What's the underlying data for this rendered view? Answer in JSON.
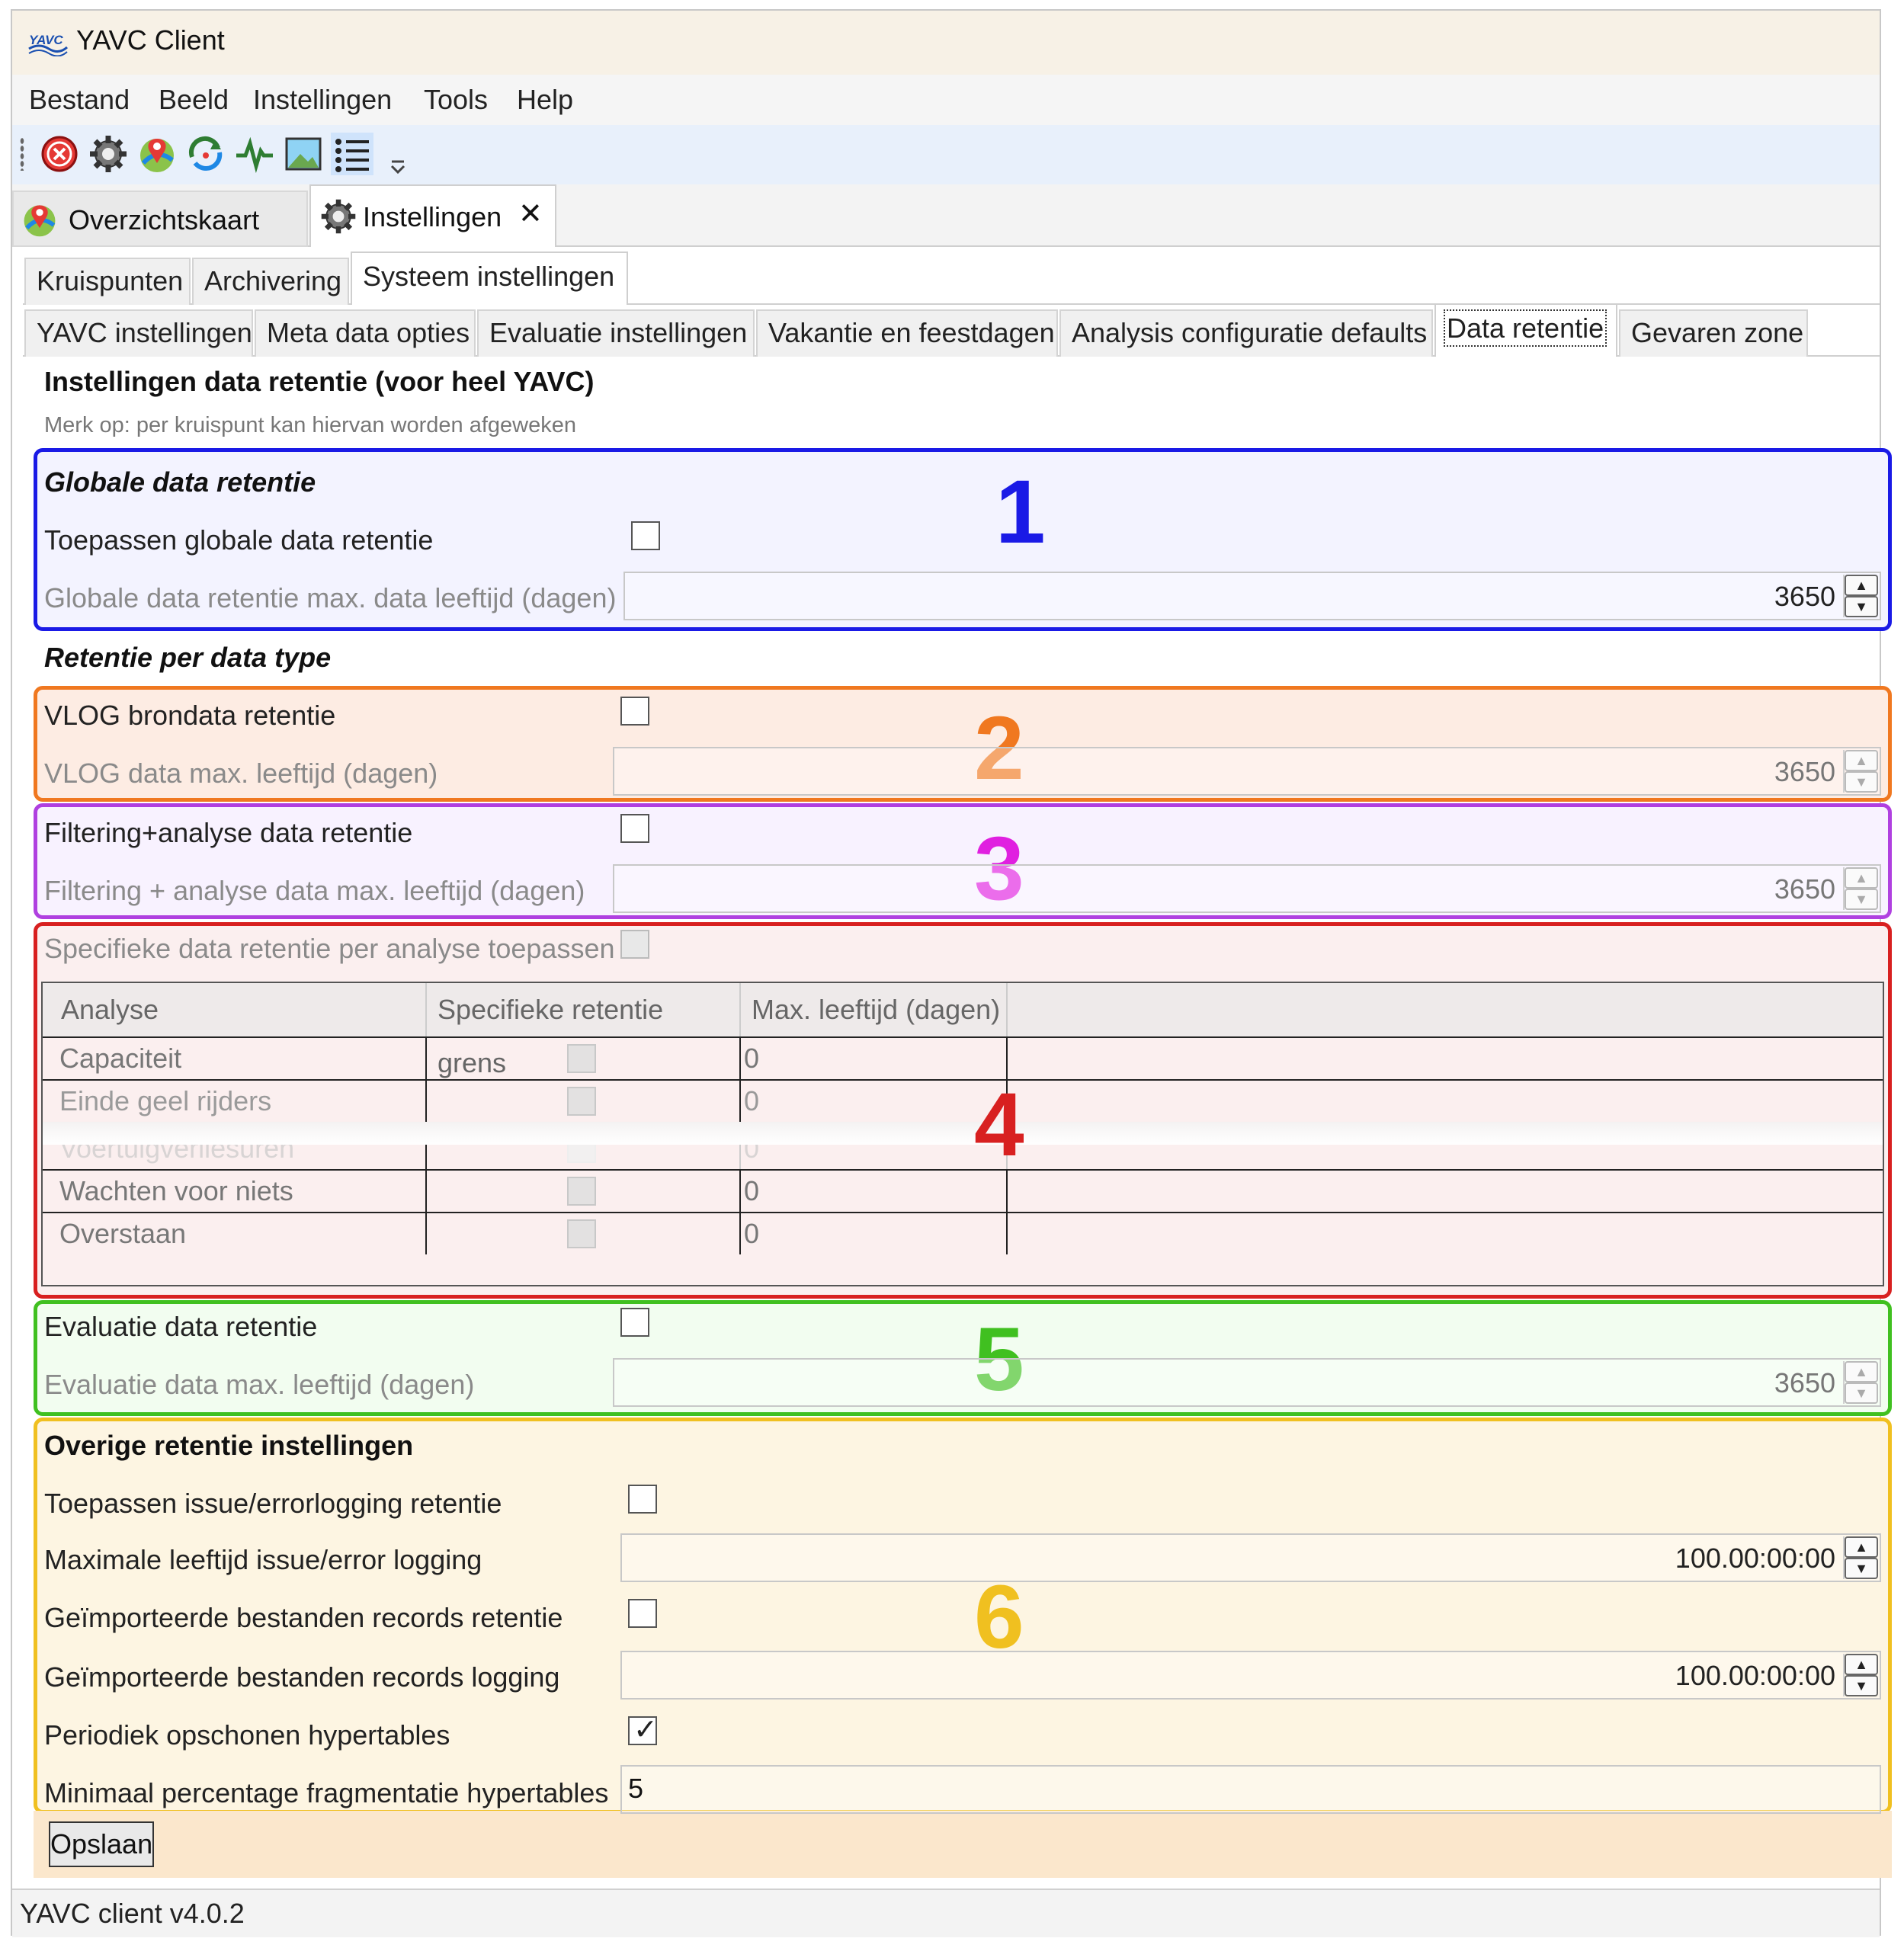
{
  "window": {
    "title": "YAVC Client",
    "logo_text": "YAVC"
  },
  "menu": [
    "Bestand",
    "Beeld",
    "Instellingen",
    "Tools",
    "Help"
  ],
  "toolbar": {
    "icons": [
      "close-red-icon",
      "gear-icon",
      "map-pin-icon",
      "refresh-icon",
      "pulse-icon",
      "image-icon",
      "list-icon",
      "overflow-chevron-icon"
    ]
  },
  "doc_tabs": [
    {
      "label": "Overzichtskaart",
      "icon": "map-pin-icon"
    },
    {
      "label": "Instellingen",
      "icon": "gear-icon",
      "close": "✕"
    }
  ],
  "settings_tabs": [
    "Kruispunten",
    "Archivering",
    "Systeem instellingen"
  ],
  "system_tabs": [
    "YAVC instellingen",
    "Meta data opties",
    "Evaluatie instellingen",
    "Vakantie en feestdagen",
    "Analysis configuratie defaults",
    "Data retentie",
    "Gevaren zone"
  ],
  "content": {
    "title": "Instellingen data retentie (voor heel YAVC)",
    "note": "Merk op: per kruispunt kan hiervan worden afgeweken"
  },
  "section1": {
    "number": "1",
    "title": "Globale data retentie",
    "apply_label": "Toepassen globale data retentie",
    "apply_checked": false,
    "max_age_label": "Globale data retentie max. data leeftijd (dagen)",
    "max_age_value": "3650",
    "color": "#1a1ae6"
  },
  "per_type_title": "Retentie per data type",
  "section2": {
    "number": "2",
    "apply_label": "VLOG brondata retentie",
    "max_age_label": "VLOG data max. leeftijd (dagen)",
    "max_age_value": "3650",
    "color": "#f07820"
  },
  "section3": {
    "number": "3",
    "apply_label": "Filtering+analyse data retentie",
    "max_age_label": "Filtering + analyse data max. leeftijd (dagen)",
    "max_age_value": "3650",
    "color": "#e020e0"
  },
  "section4": {
    "number": "4",
    "apply_label": "Specifieke data retentie per analyse toepassen",
    "color": "#d82020",
    "columns": [
      "Analyse",
      "Specifieke retentie grens",
      "Max. leeftijd (dagen)"
    ],
    "rows": [
      {
        "name": "Capaciteit",
        "value": "0"
      },
      {
        "name": "Einde geel rijders",
        "value": "0"
      },
      {
        "name": "Voertuigverliesuren",
        "value": "0"
      },
      {
        "name": "Wachten voor niets",
        "value": "0"
      },
      {
        "name": "Overstaan",
        "value": "0"
      }
    ]
  },
  "section5": {
    "number": "5",
    "apply_label": "Evaluatie data retentie",
    "max_age_label": "Evaluatie data max. leeftijd (dagen)",
    "max_age_value": "3650",
    "color": "#40c020"
  },
  "section6": {
    "number": "6",
    "title": "Overige retentie instellingen",
    "color": "#f0c020",
    "issue_apply_label": "Toepassen issue/errorlogging retentie",
    "issue_max_label": "Maximale leeftijd issue/error logging",
    "issue_max_value": "100.00:00:00",
    "imported_apply_label": "Geïmporteerde bestanden records retentie",
    "imported_log_label": "Geïmporteerde bestanden records logging",
    "imported_log_value": "100.00:00:00",
    "hypertables_label": "Periodiek opschonen hypertables",
    "hypertables_checked": true,
    "fragmentation_label": "Minimaal percentage fragmentatie hypertables",
    "fragmentation_value": "5"
  },
  "save_label": "Opslaan",
  "status": "YAVC client v4.0.2"
}
